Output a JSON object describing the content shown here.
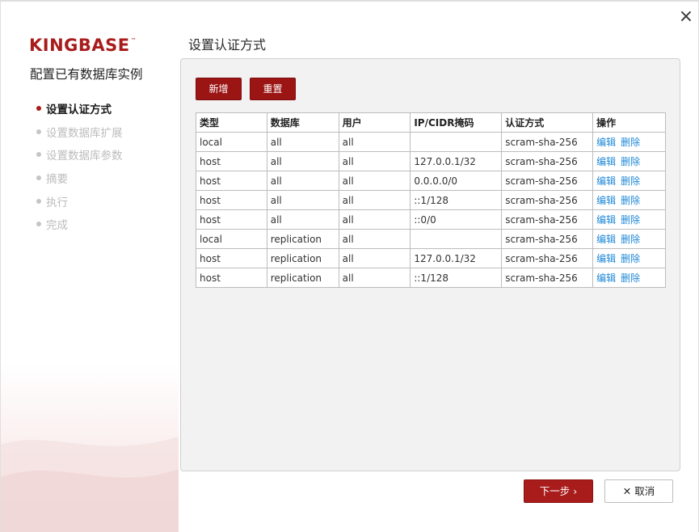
{
  "window": {
    "close_icon": "×"
  },
  "brand": {
    "logo": "KINGBASE",
    "trademark": "™"
  },
  "sidebar": {
    "title": "配置已有数据库实例",
    "steps": [
      {
        "label": "设置认证方式",
        "active": true
      },
      {
        "label": "设置数据库扩展",
        "active": false
      },
      {
        "label": "设置数据库参数",
        "active": false
      },
      {
        "label": "摘要",
        "active": false
      },
      {
        "label": "执行",
        "active": false
      },
      {
        "label": "完成",
        "active": false
      }
    ]
  },
  "main": {
    "title": "设置认证方式",
    "toolbar": {
      "add_label": "新增",
      "reset_label": "重置"
    },
    "table": {
      "headers": [
        "类型",
        "数据库",
        "用户",
        "IP/CIDR掩码",
        "认证方式",
        "操作"
      ],
      "rows": [
        {
          "type": "local",
          "database": "all",
          "user": "all",
          "ip": "",
          "method": "scram-sha-256",
          "edit": "编辑",
          "delete": "删除"
        },
        {
          "type": "host",
          "database": "all",
          "user": "all",
          "ip": "127.0.0.1/32",
          "method": "scram-sha-256",
          "edit": "编辑",
          "delete": "删除"
        },
        {
          "type": "host",
          "database": "all",
          "user": "all",
          "ip": "0.0.0.0/0",
          "method": "scram-sha-256",
          "edit": "编辑",
          "delete": "删除"
        },
        {
          "type": "host",
          "database": "all",
          "user": "all",
          "ip": "::1/128",
          "method": "scram-sha-256",
          "edit": "编辑",
          "delete": "删除"
        },
        {
          "type": "host",
          "database": "all",
          "user": "all",
          "ip": "::0/0",
          "method": "scram-sha-256",
          "edit": "编辑",
          "delete": "删除"
        },
        {
          "type": "local",
          "database": "replication",
          "user": "all",
          "ip": "",
          "method": "scram-sha-256",
          "edit": "编辑",
          "delete": "删除"
        },
        {
          "type": "host",
          "database": "replication",
          "user": "all",
          "ip": "127.0.0.1/32",
          "method": "scram-sha-256",
          "edit": "编辑",
          "delete": "删除"
        },
        {
          "type": "host",
          "database": "replication",
          "user": "all",
          "ip": "::1/128",
          "method": "scram-sha-256",
          "edit": "编辑",
          "delete": "删除"
        }
      ]
    }
  },
  "footer": {
    "next_label": "下一步 ›",
    "cancel_label": "✕ 取消"
  },
  "colors": {
    "brand": "#a81c1c",
    "link": "#1e88d8",
    "panel_bg": "#f2f2f2"
  }
}
